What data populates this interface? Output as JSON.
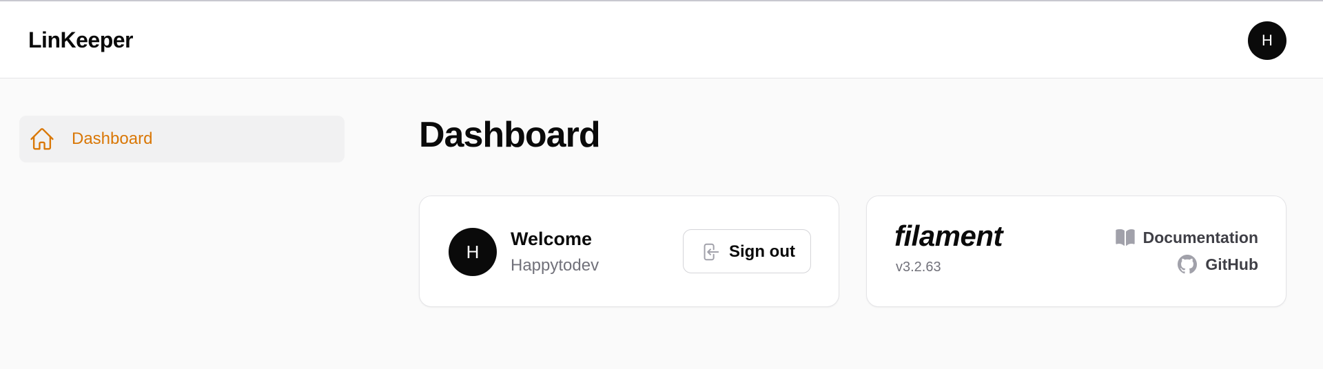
{
  "app": {
    "brand": "LinKeeper",
    "avatar_initial": "H"
  },
  "sidebar": {
    "items": [
      {
        "label": "Dashboard",
        "icon": "home-icon",
        "active": true,
        "color": "#d97706"
      }
    ]
  },
  "main": {
    "title": "Dashboard",
    "welcome_card": {
      "avatar_initial": "H",
      "title": "Welcome",
      "username": "Happytodev",
      "signout_label": "Sign out",
      "signout_icon": "sign-out-icon"
    },
    "filament_card": {
      "logo_text": "filament",
      "version": "v3.2.63",
      "documentation_label": "Documentation",
      "documentation_icon": "book-icon",
      "github_label": "GitHub",
      "github_icon": "github-icon"
    }
  }
}
